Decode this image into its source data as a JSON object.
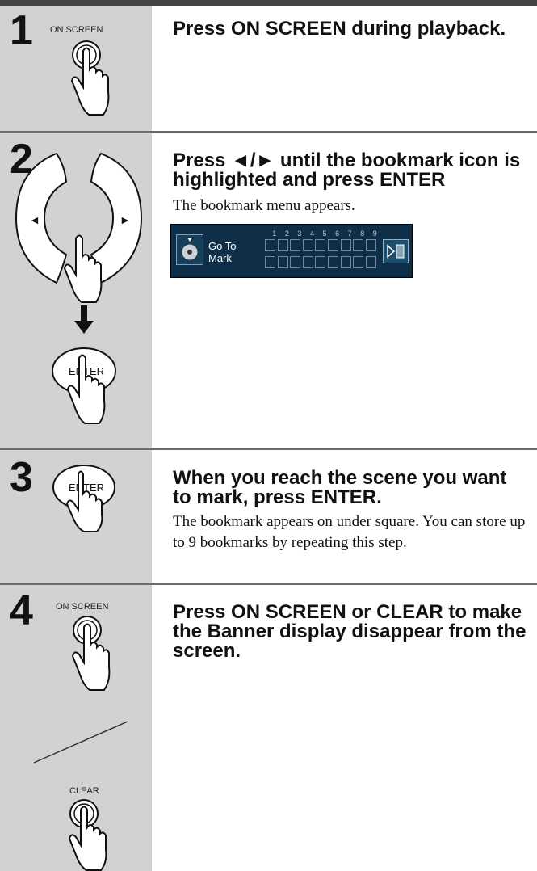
{
  "steps": [
    {
      "number": "1",
      "title": "Press ON SCREEN during playback.",
      "description": "",
      "illustration": {
        "button_label": "ON SCREEN"
      }
    },
    {
      "number": "2",
      "title": "Press ◄/► until the bookmark icon is highlighted and press ENTER",
      "description": "The bookmark menu appears.",
      "illustration": {
        "left_arrow": "◄",
        "right_arrow": "►",
        "enter_label": "ENTER"
      },
      "osd": {
        "label": "Go To Mark",
        "numbers": [
          "1",
          "2",
          "3",
          "4",
          "5",
          "6",
          "7",
          "8",
          "9"
        ]
      }
    },
    {
      "number": "3",
      "title": "When you reach the scene you want to mark, press ENTER.",
      "description": "The bookmark appears on under square. You can store up to 9 bookmarks by repeating this step.",
      "illustration": {
        "button_label": "ENTER"
      }
    },
    {
      "number": "4",
      "title": "Press ON SCREEN or CLEAR to make the Banner display disappear from the screen.",
      "description": "",
      "illustration": {
        "button_label": "ON SCREEN",
        "second_button_label": "CLEAR"
      }
    }
  ],
  "colors": {
    "panel": "#d2d2d2",
    "separator": "#6a6a6a",
    "osd_background": "#0e2f47"
  }
}
